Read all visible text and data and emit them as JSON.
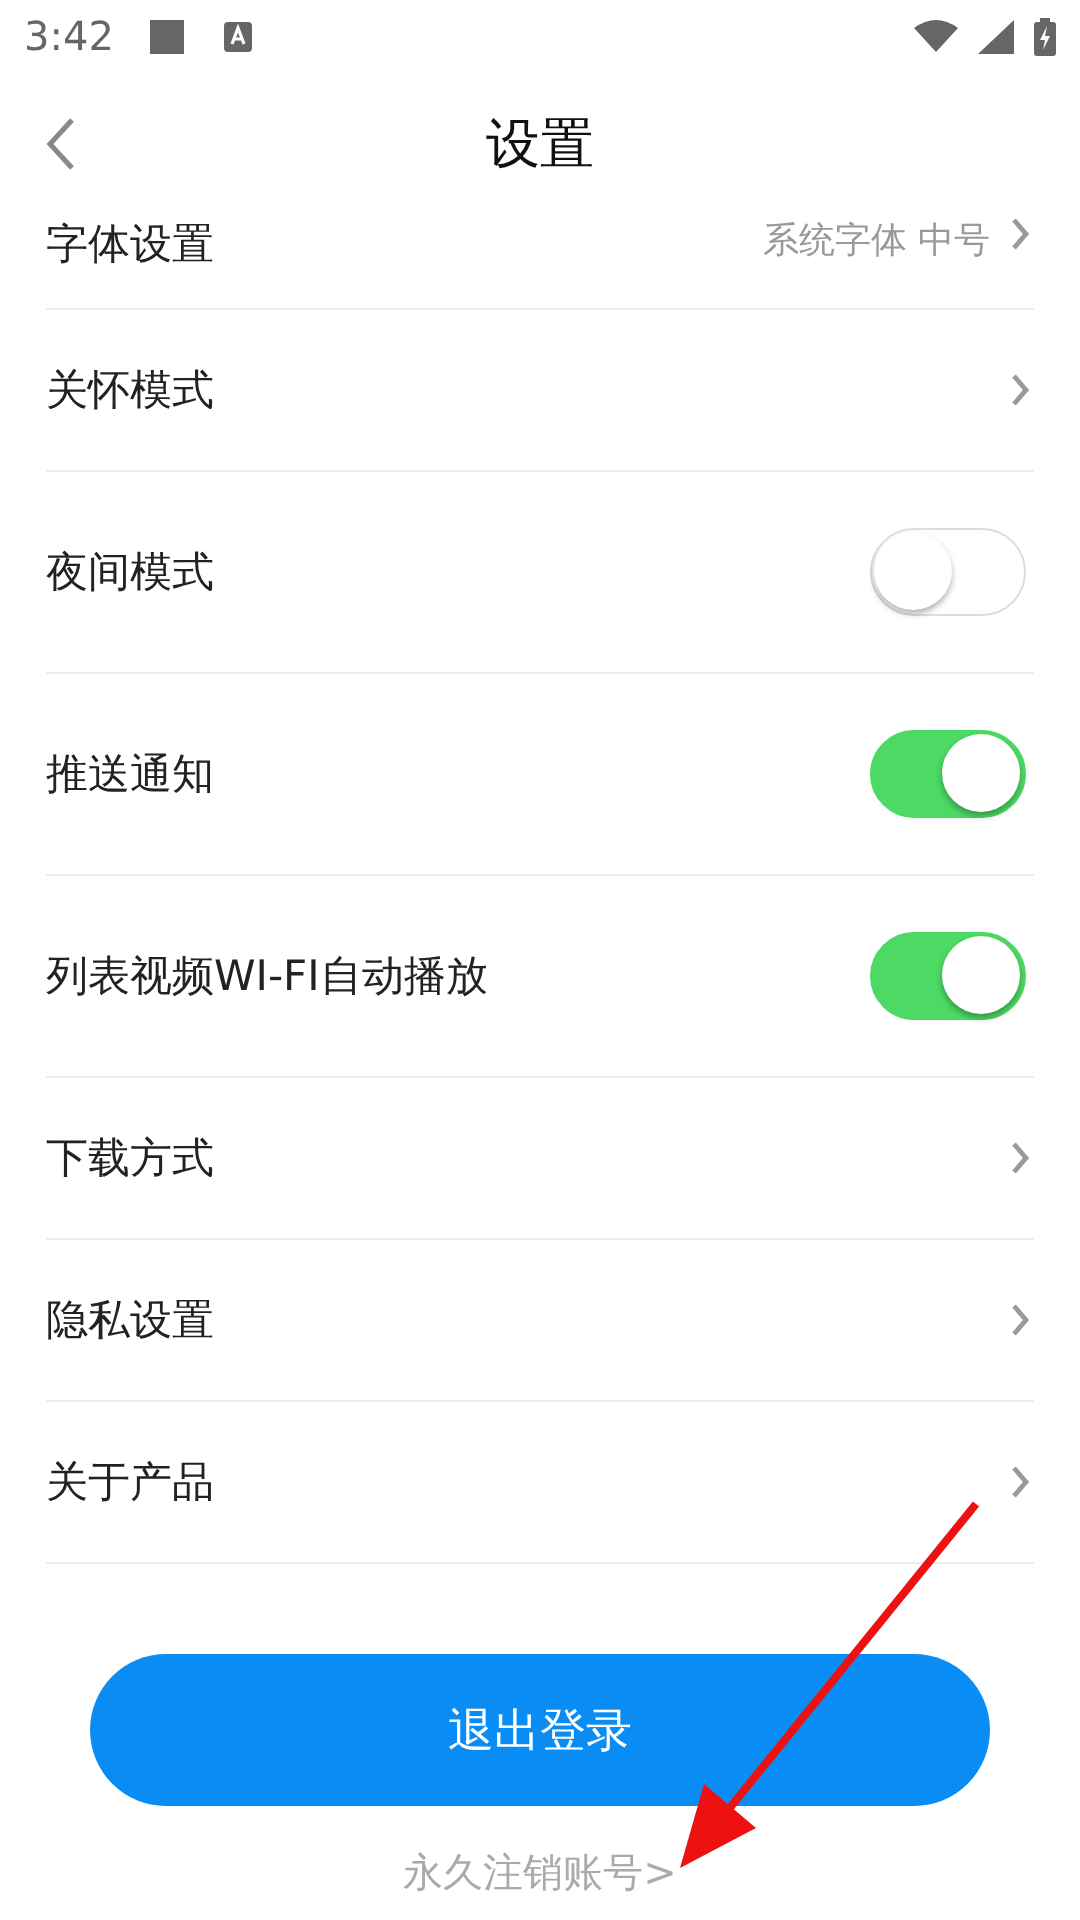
{
  "status_bar": {
    "time": "3:42"
  },
  "header": {
    "title": "设置"
  },
  "rows": [
    {
      "kind": "link",
      "label": "字体设置",
      "value": "系统字体 中号"
    },
    {
      "kind": "link",
      "label": "关怀模式"
    },
    {
      "kind": "toggle",
      "label": "夜间模式",
      "on": false
    },
    {
      "kind": "toggle",
      "label": "推送通知",
      "on": true
    },
    {
      "kind": "toggle",
      "label": "列表视频WI-FI自动播放",
      "on": true
    },
    {
      "kind": "link",
      "label": "下载方式"
    },
    {
      "kind": "link",
      "label": "隐私设置"
    },
    {
      "kind": "link",
      "label": "关于产品"
    }
  ],
  "logout_button": "退出登录",
  "delete_account_link": "永久注销账号>",
  "annotation": {
    "kind": "arrow",
    "color": "#ee1111"
  }
}
